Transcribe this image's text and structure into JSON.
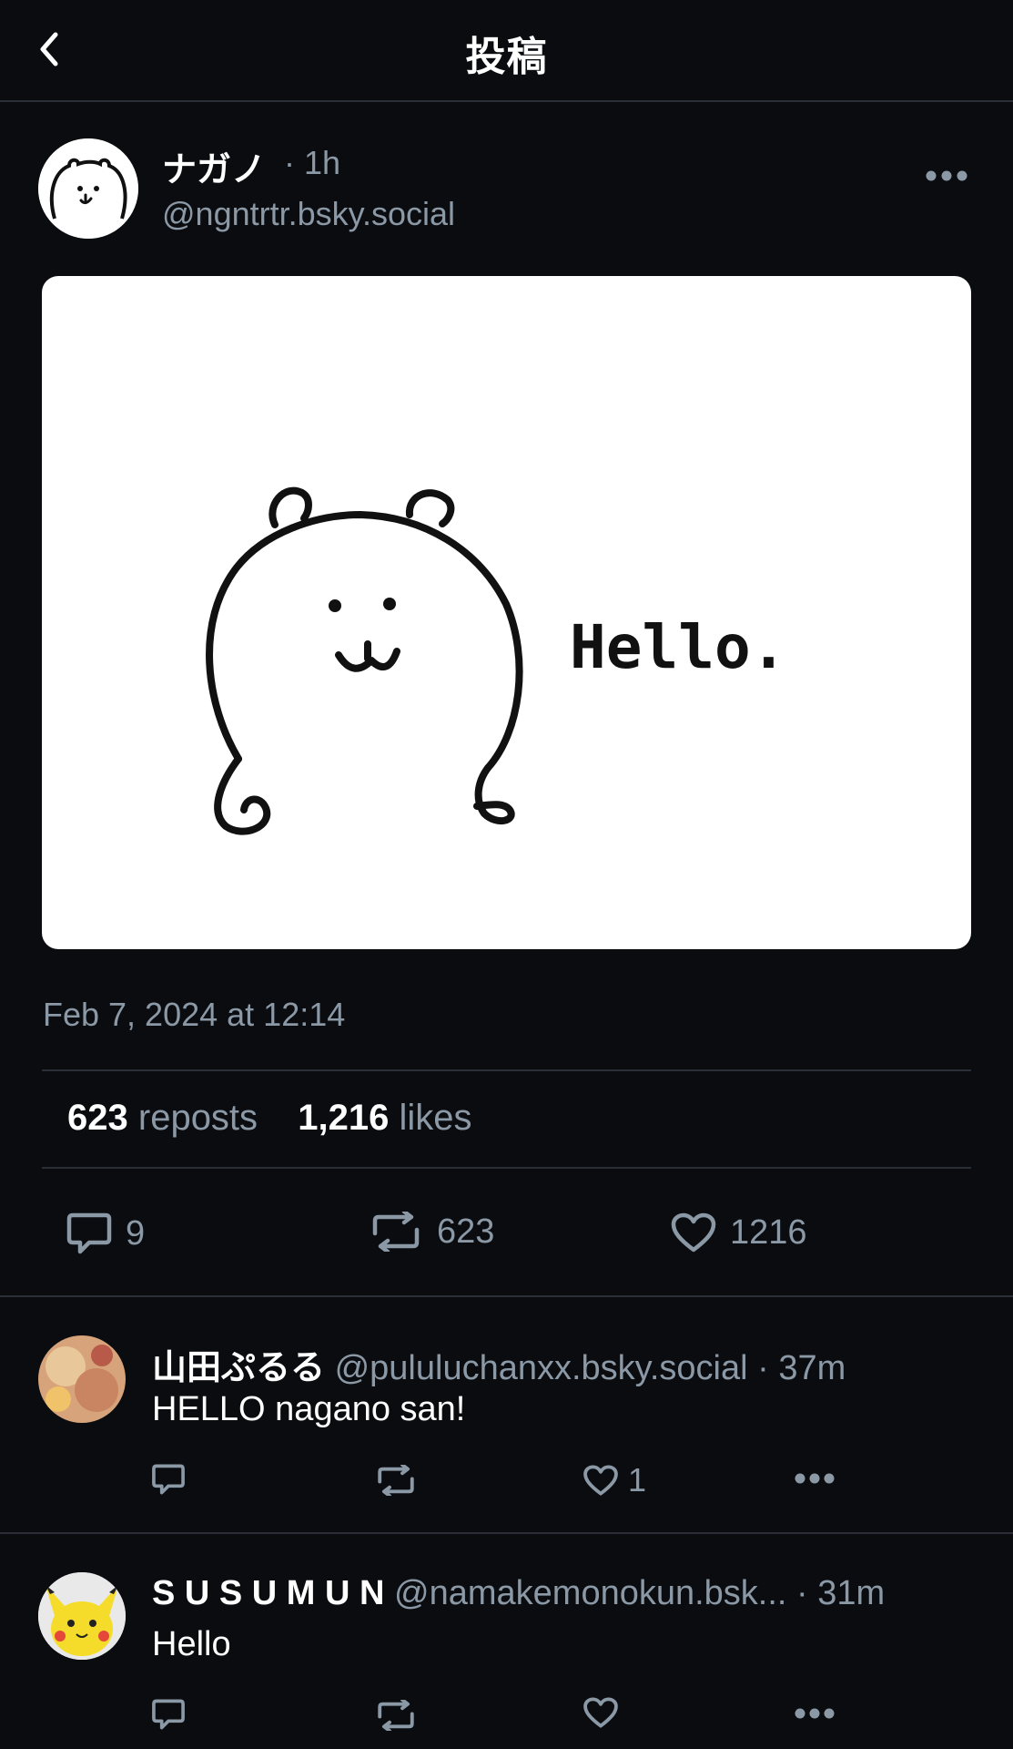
{
  "header": {
    "title": "投稿",
    "back_icon": "chevron-left-icon"
  },
  "post": {
    "author_name": "ナガノ",
    "time": "· 1h",
    "handle": "@ngntrtr.bsky.social",
    "image_caption_text": "Hello.",
    "timestamp": "Feb 7, 2024 at 12:14",
    "stats": {
      "reposts_count": "623",
      "reposts_label": "reposts",
      "likes_count": "1,216",
      "likes_label": "likes"
    },
    "actions": {
      "replies": "9",
      "reposts": "623",
      "likes": "1216"
    }
  },
  "replies": [
    {
      "name": "山田ぷるる",
      "handle": "@pululuchanxx.bsky.social",
      "time": "· 37m",
      "text": "HELLO nagano san!",
      "likes": "1"
    },
    {
      "name": "S U S U M U N",
      "handle": "@namakemonokun.bsk...",
      "time": "· 31m",
      "text": "Hello",
      "likes": ""
    }
  ],
  "colors": {
    "background": "#0a0c10",
    "muted_text": "#8b98a5",
    "divider": "#2a2f37"
  }
}
